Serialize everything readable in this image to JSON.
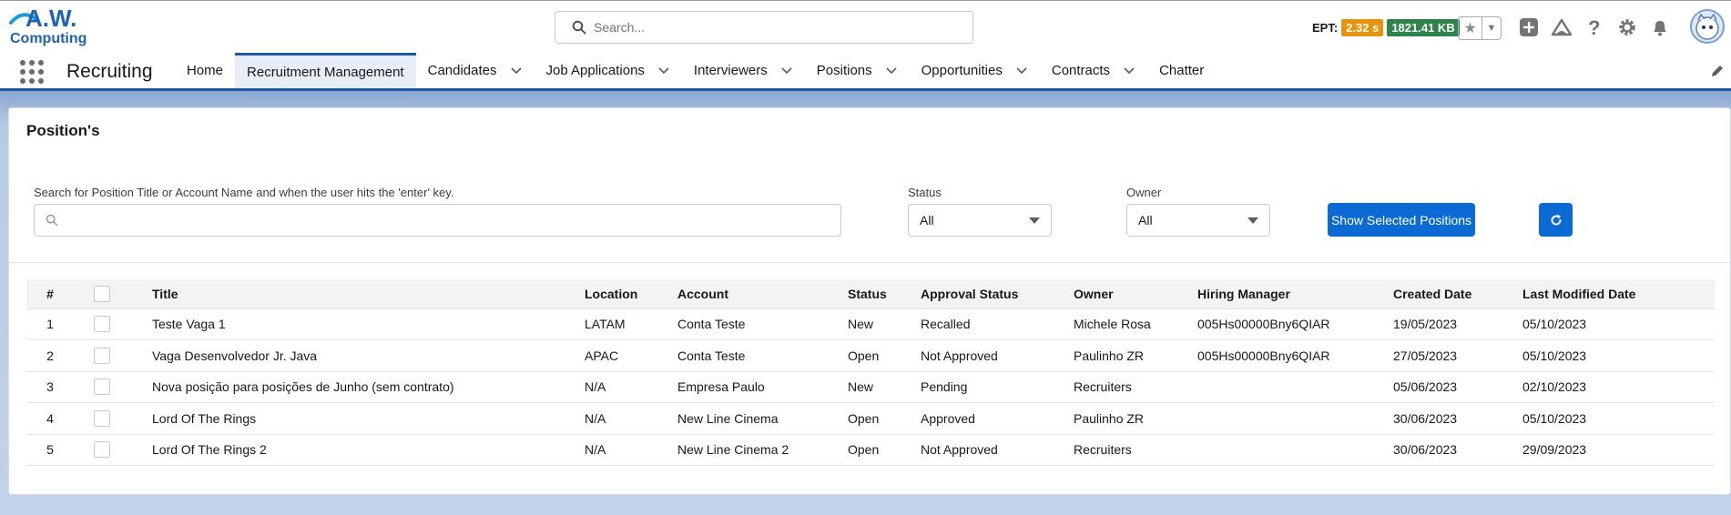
{
  "header": {
    "logo_top": "A.W.",
    "logo_bottom": "Computing",
    "search_placeholder": "Search...",
    "ept_label": "EPT:",
    "ept_time": "2.32 s",
    "ept_size": "1821.41 KB",
    "colors": {
      "ept_time": "#e8930c",
      "ept_size": "#2e844a",
      "brand": "#1b5aa6"
    }
  },
  "nav": {
    "app_name": "Recruiting",
    "items": [
      {
        "label": "Home",
        "dropdown": false,
        "active": false
      },
      {
        "label": "Recruitment Management",
        "dropdown": false,
        "active": true
      },
      {
        "label": "Candidates",
        "dropdown": true,
        "active": false
      },
      {
        "label": "Job Applications",
        "dropdown": true,
        "active": false
      },
      {
        "label": "Interviewers",
        "dropdown": true,
        "active": false
      },
      {
        "label": "Positions",
        "dropdown": true,
        "active": false
      },
      {
        "label": "Opportunities",
        "dropdown": true,
        "active": false
      },
      {
        "label": "Contracts",
        "dropdown": true,
        "active": false
      },
      {
        "label": "Chatter",
        "dropdown": false,
        "active": false
      }
    ]
  },
  "card": {
    "title": "Position's",
    "search_label": "Search for Position Title or Account Name and when the user hits the 'enter' key.",
    "search_value": "",
    "status_label": "Status",
    "status_value": "All",
    "owner_label": "Owner",
    "owner_value": "All",
    "show_button": "Show Selected Positions",
    "primary_color": "#0b6ad3"
  },
  "table": {
    "headers": [
      "#",
      "",
      "Title",
      "Location",
      "Account",
      "Status",
      "Approval Status",
      "Owner",
      "Hiring Manager",
      "Created Date",
      "Last Modified Date"
    ],
    "rows": [
      [
        "1",
        "Teste Vaga 1",
        "LATAM",
        "Conta Teste",
        "New",
        "Recalled",
        "Michele Rosa",
        "005Hs00000Bny6QIAR",
        "19/05/2023",
        "05/10/2023"
      ],
      [
        "2",
        "Vaga Desenvolvedor Jr. Java",
        "APAC",
        "Conta Teste",
        "Open",
        "Not Approved",
        "Paulinho ZR",
        "005Hs00000Bny6QIAR",
        "27/05/2023",
        "05/10/2023"
      ],
      [
        "3",
        "Nova posição para posições de Junho (sem contrato)",
        "N/A",
        "Empresa Paulo",
        "New",
        "Pending",
        "Recruiters",
        "",
        "05/06/2023",
        "02/10/2023"
      ],
      [
        "4",
        "Lord Of The Rings",
        "N/A",
        "New Line Cinema",
        "Open",
        "Approved",
        "Paulinho ZR",
        "",
        "30/06/2023",
        "05/10/2023"
      ],
      [
        "5",
        "Lord Of The Rings 2",
        "N/A",
        "New Line Cinema 2",
        "Open",
        "Not Approved",
        "Recruiters",
        "",
        "30/06/2023",
        "29/09/2023"
      ]
    ]
  }
}
